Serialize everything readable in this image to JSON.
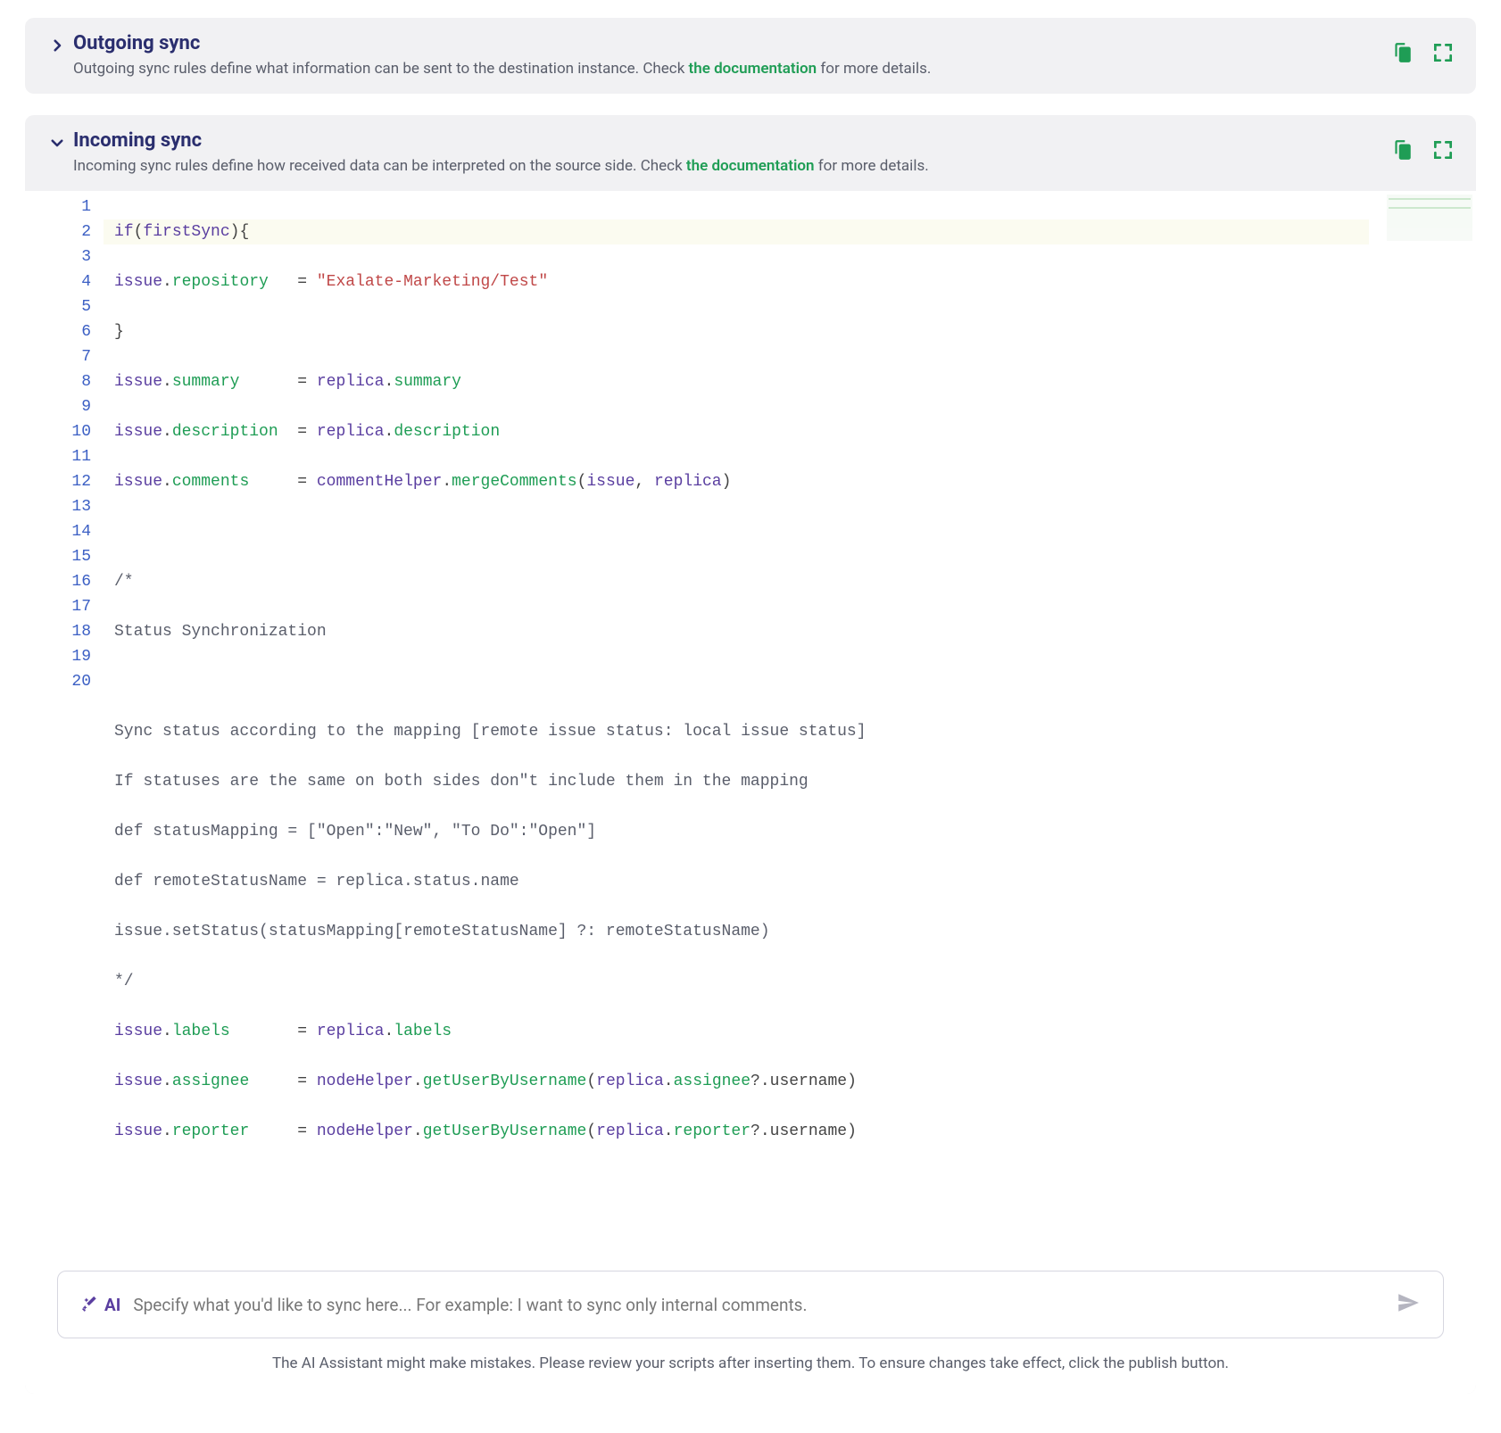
{
  "outgoing": {
    "title": "Outgoing sync",
    "desc_pre": "Outgoing sync rules define what information can be sent to the destination instance. Check ",
    "doc_link": "the documentation",
    "desc_post": " for more details."
  },
  "incoming": {
    "title": "Incoming sync",
    "desc_pre": "Incoming sync rules define how received data can be interpreted on the source side. Check ",
    "doc_link": "the documentation",
    "desc_post": " for more details."
  },
  "code": {
    "l1_if": "if",
    "l1_fs": "firstSync",
    "l2_issue": "issue",
    "l2_repo": "repository",
    "l2_val": "\"Exalate-Marketing/Test\"",
    "l4_sum": "summary",
    "l4_repl": "replica",
    "l5_desc": "description",
    "l6_comm": "comments",
    "l6_ch": "commentHelper",
    "l6_mc": "mergeComments",
    "l8": "/*",
    "l9": "Status Synchronization",
    "l11": "Sync status according to the mapping [remote issue status: local issue status]",
    "l12": "If statuses are the same on both sides don\"t include them in the mapping",
    "l13": "def statusMapping = [\"Open\":\"New\", \"To Do\":\"Open\"]",
    "l14": "def remoteStatusName = replica.status.name",
    "l15": "issue.setStatus(statusMapping[remoteStatusName] ?: remoteStatusName)",
    "l16": "*/",
    "l17_lbl": "labels",
    "l18_asg": "assignee",
    "l18_nh": "nodeHelper",
    "l18_gu": "getUserByUsername",
    "l18_un": "username",
    "l19_rep": "reporter"
  },
  "ai": {
    "label": "AI",
    "placeholder": "Specify what you'd like to sync here...   For example: I want to sync only internal comments.",
    "note": "The AI Assistant might make mistakes. Please review your scripts after inserting them. To ensure changes take effect, click the publish button."
  }
}
